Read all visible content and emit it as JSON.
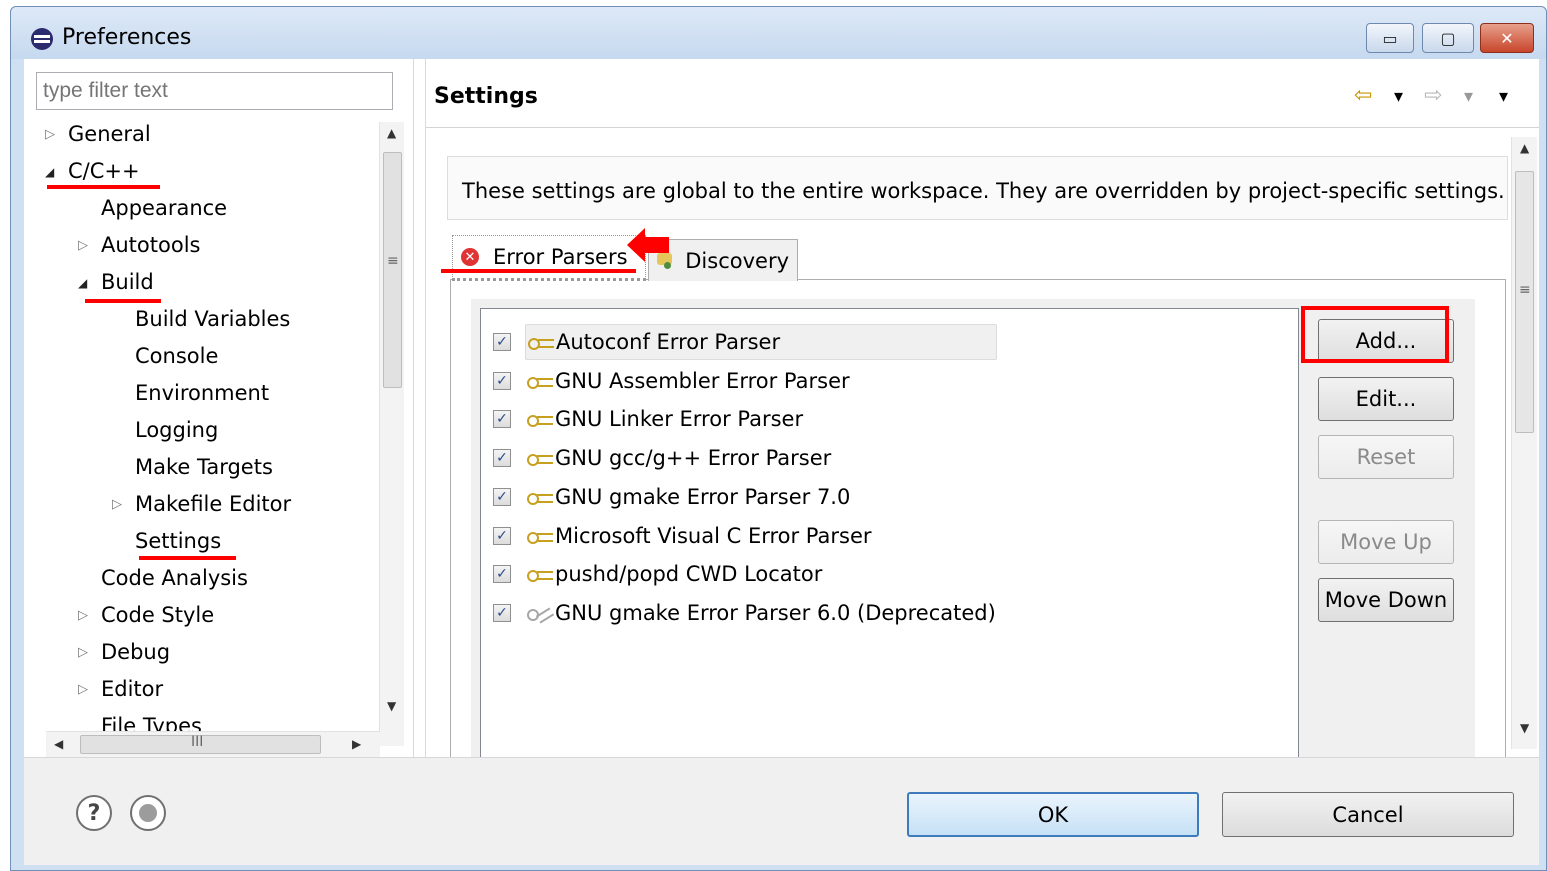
{
  "window": {
    "title": "Preferences",
    "controls": {
      "minimize": "▭",
      "maximize": "▢",
      "close": "✕"
    }
  },
  "left_pane": {
    "filter_placeholder": "type filter text",
    "tree": [
      {
        "label": "General",
        "twisty": "▷"
      },
      {
        "label": "C/C++",
        "twisty": "◢"
      },
      {
        "label": "Appearance",
        "twisty": ""
      },
      {
        "label": "Autotools",
        "twisty": "▷"
      },
      {
        "label": "Build",
        "twisty": "◢"
      },
      {
        "label": "Build Variables",
        "twisty": ""
      },
      {
        "label": "Console",
        "twisty": ""
      },
      {
        "label": "Environment",
        "twisty": ""
      },
      {
        "label": "Logging",
        "twisty": ""
      },
      {
        "label": "Make Targets",
        "twisty": ""
      },
      {
        "label": "Makefile Editor",
        "twisty": "▷"
      },
      {
        "label": "Settings",
        "twisty": ""
      },
      {
        "label": "Code Analysis",
        "twisty": ""
      },
      {
        "label": "Code Style",
        "twisty": "▷"
      },
      {
        "label": "Debug",
        "twisty": "▷"
      },
      {
        "label": "Editor",
        "twisty": "▷"
      },
      {
        "label": "File Types",
        "twisty": ""
      }
    ],
    "scroll_glyphs": {
      "up": "▲",
      "down": "▼",
      "left": "◀",
      "right": "▶",
      "grip_v": "≡",
      "grip_h": "III"
    }
  },
  "page": {
    "title": "Settings",
    "nav": {
      "back": "⇦",
      "forward": "⇨",
      "dropdown": "▾"
    },
    "info_text": "These settings are global to the entire workspace.  They are overridden by project-specific settings.",
    "tabs": [
      {
        "label": "Error Parsers",
        "icon": "error-icon",
        "active": true
      },
      {
        "label": "Discovery",
        "icon": "discovery-icon",
        "active": false
      }
    ],
    "error_parsers": [
      {
        "label": "Autoconf Error Parser",
        "checked": true,
        "deprecated": false
      },
      {
        "label": "GNU Assembler Error Parser",
        "checked": true,
        "deprecated": false
      },
      {
        "label": "GNU Linker Error Parser",
        "checked": true,
        "deprecated": false
      },
      {
        "label": "GNU gcc/g++ Error Parser",
        "checked": true,
        "deprecated": false
      },
      {
        "label": "GNU gmake Error Parser 7.0",
        "checked": true,
        "deprecated": false
      },
      {
        "label": "Microsoft Visual C Error Parser",
        "checked": true,
        "deprecated": false
      },
      {
        "label": "pushd/popd CWD Locator",
        "checked": true,
        "deprecated": false
      },
      {
        "label": "GNU gmake Error Parser 6.0 (Deprecated)",
        "checked": true,
        "deprecated": true
      }
    ],
    "check_glyph": "✓",
    "buttons": {
      "add": "Add...",
      "edit": "Edit...",
      "reset": "Reset",
      "move_up": "Move Up",
      "move_down": "Move Down"
    }
  },
  "footer": {
    "help_glyph": "?",
    "ok": "OK",
    "cancel": "Cancel"
  },
  "annotation_color": "#ff0000"
}
